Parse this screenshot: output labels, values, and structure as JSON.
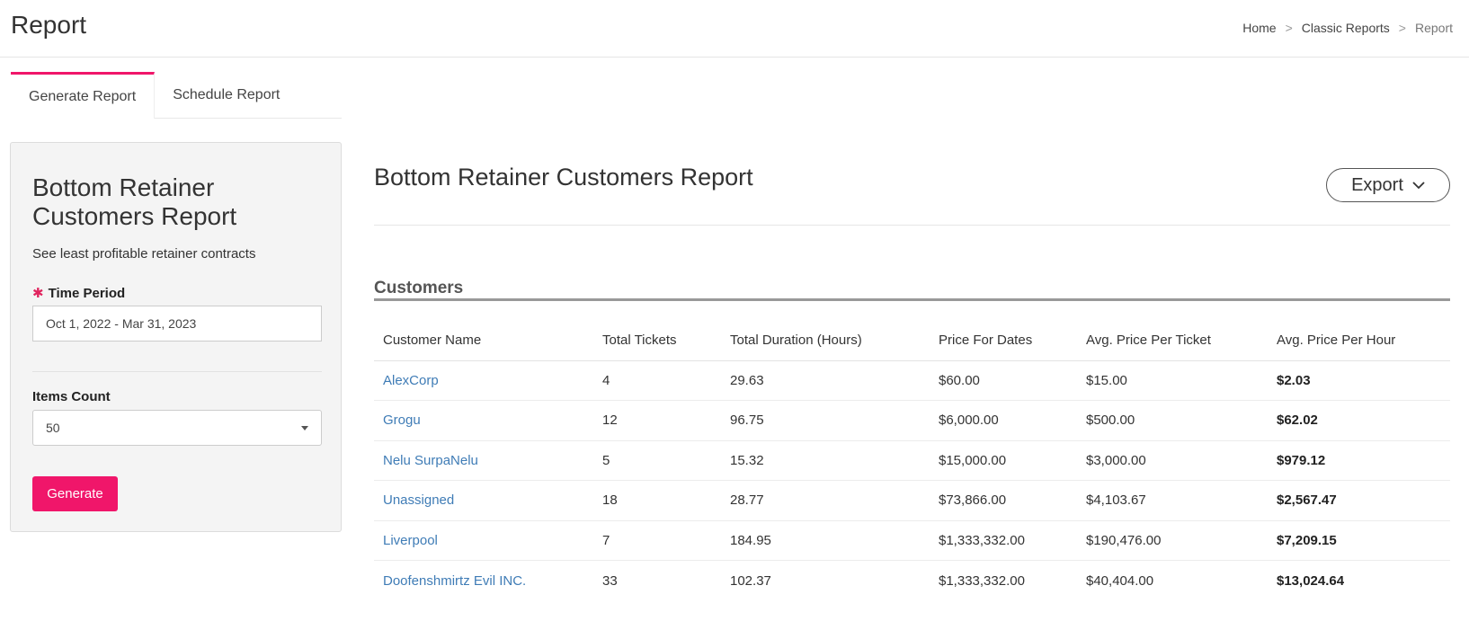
{
  "header": {
    "title": "Report",
    "breadcrumb": {
      "home": "Home",
      "section": "Classic Reports",
      "current": "Report",
      "separator": ">"
    }
  },
  "tabs": [
    {
      "label": "Generate Report",
      "active": true
    },
    {
      "label": "Schedule Report",
      "active": false
    }
  ],
  "form": {
    "title": "Bottom Retainer Customers Report",
    "description": "See least profitable retainer contracts",
    "time_period": {
      "required_mark": "✱",
      "label": "Time Period",
      "value": "Oct 1, 2022 - Mar 31, 2023"
    },
    "items_count": {
      "label": "Items Count",
      "value": "50"
    },
    "generate_label": "Generate"
  },
  "report": {
    "title": "Bottom Retainer Customers Report",
    "export_label": "Export",
    "section_title": "Customers",
    "columns": [
      "Customer Name",
      "Total Tickets",
      "Total Duration (Hours)",
      "Price For Dates",
      "Avg. Price Per Ticket",
      "Avg. Price Per Hour"
    ],
    "rows": [
      [
        "AlexCorp",
        "4",
        "29.63",
        "$60.00",
        "$15.00",
        "$2.03"
      ],
      [
        "Grogu",
        "12",
        "96.75",
        "$6,000.00",
        "$500.00",
        "$62.02"
      ],
      [
        "Nelu SurpaNelu",
        "5",
        "15.32",
        "$15,000.00",
        "$3,000.00",
        "$979.12"
      ],
      [
        "Unassigned",
        "18",
        "28.77",
        "$73,866.00",
        "$4,103.67",
        "$2,567.47"
      ],
      [
        "Liverpool",
        "7",
        "184.95",
        "$1,333,332.00",
        "$190,476.00",
        "$7,209.15"
      ],
      [
        "Doofenshmirtz Evil INC.",
        "33",
        "102.37",
        "$1,333,332.00",
        "$40,404.00",
        "$13,024.64"
      ]
    ]
  },
  "colors": {
    "accent": "#f0166a",
    "link": "#3f7cb6",
    "panel_bg": "#f4f4f4"
  },
  "icons": {
    "export": "chevron-down-icon",
    "select": "caret-down-icon",
    "required": "asterisk-icon"
  }
}
